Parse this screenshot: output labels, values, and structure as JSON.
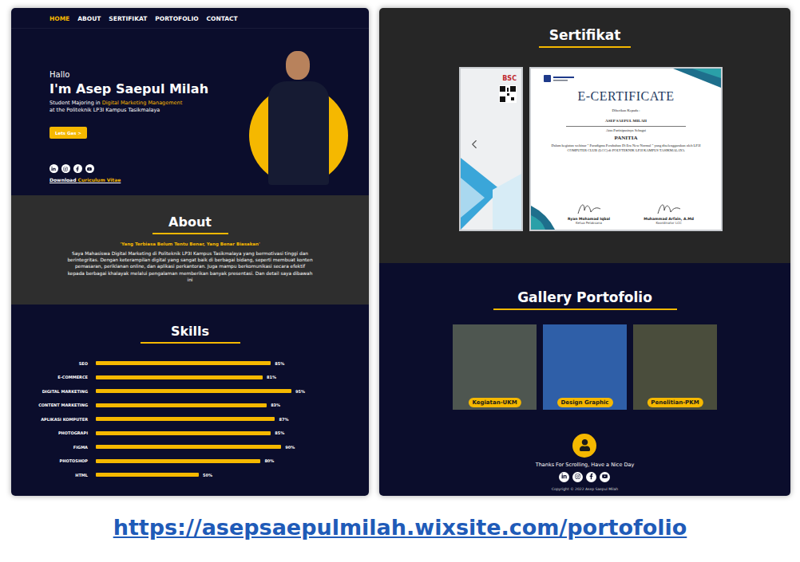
{
  "nav": [
    {
      "label": "HOME",
      "selected": true
    },
    {
      "label": "ABOUT",
      "selected": false
    },
    {
      "label": "SERTIFIKAT",
      "selected": false
    },
    {
      "label": "PORTOFOLIO",
      "selected": false
    },
    {
      "label": "CONTACT",
      "selected": false
    }
  ],
  "hero": {
    "greeting": "Hallo",
    "name": "I'm Asep Saepul Milah",
    "subtitle": {
      "before": "Student Majoring in ",
      "highlight": "Digital Marketing Management",
      "line2": "at the Politeknik LP3I Kampus Tasikmalaya"
    },
    "button": "Lets Gas >",
    "download": {
      "before": "Download ",
      "link": "Curiculum Vitae"
    }
  },
  "about": {
    "title": "About",
    "quote": "'Yang Terbiasa Belum Tentu Benar, Yang Benar Biasakan'",
    "body": "Saya Mahasiswa Digital Marketing di Politeknik LP3I Kampus Tasikmalaya yang bermotivasi tinggi dan berintegritas. Dengan keterampilan digital yang sangat baik di berbagai bidang, seperti membuat konten pemasaran, periklanan online, dan aplikasi perkantoran. Juga mampu berkomunikasi secara efektif kepada berbagai khalayak melalui pengalaman memberikan banyak presentasi. Dan detail saya dibawah ini"
  },
  "skills": {
    "title": "Skills",
    "items": [
      {
        "name": "SEO",
        "reading": "85%",
        "level": 0.85
      },
      {
        "name": "E-COMMERCE",
        "reading": "81%",
        "level": 0.81
      },
      {
        "name": "DIGITAL MARKETING",
        "reading": "95%",
        "level": 0.95
      },
      {
        "name": "CONTENT MARKETING",
        "reading": "83%",
        "level": 0.83
      },
      {
        "name": "APLIKASI KOMPUTER",
        "reading": "87%",
        "level": 0.87
      },
      {
        "name": "PHOTOGRAPI",
        "reading": "85%",
        "level": 0.85
      },
      {
        "name": "FIGMA",
        "reading": "90%",
        "level": 0.9
      },
      {
        "name": "PHOTOSHOP",
        "reading": "80%",
        "level": 0.8
      },
      {
        "name": "HTML",
        "reading": "50%",
        "level": 0.5
      }
    ]
  },
  "certificates": {
    "title": "Sertifikat",
    "previous": {
      "logo": "BSC"
    },
    "current": {
      "title": "E-CERTIFICATE",
      "given_to": "Diberikan Kepada :",
      "recipient": "ASEP SAEPUL MILAH",
      "participation": "Atas Partisipasinya Sebagai",
      "role": "PANITIA",
      "description": "Dalam kegiatan webinar \" Paradigma Perubahan Di Era New Normal \" yang diselenggarakan oleh LP3I COMPUTER CLUB (LCC) di POLYTEKNIK LP3I KAMPUS TASIKMALAYA",
      "signatories": [
        {
          "name": "Ryan Mohamad Iqbal",
          "position": "Ketua Pelaksana"
        },
        {
          "name": "Muhammad Arfain, A.Md",
          "position": "Koordinator LCC"
        }
      ]
    }
  },
  "gallery": {
    "title": "Gallery Portofolio",
    "items": [
      {
        "label": "Kegiatan-UKM"
      },
      {
        "label": "Design Graphic"
      },
      {
        "label": "Penelitian-PKM"
      }
    ]
  },
  "footer": {
    "message": "Thanks For Scrolling, Have a Nice Day",
    "copyright": "Copyright © 2022 Asep Saepul Milah"
  },
  "link": "https://asepsaepulmilah.wixsite.com/portofolio"
}
